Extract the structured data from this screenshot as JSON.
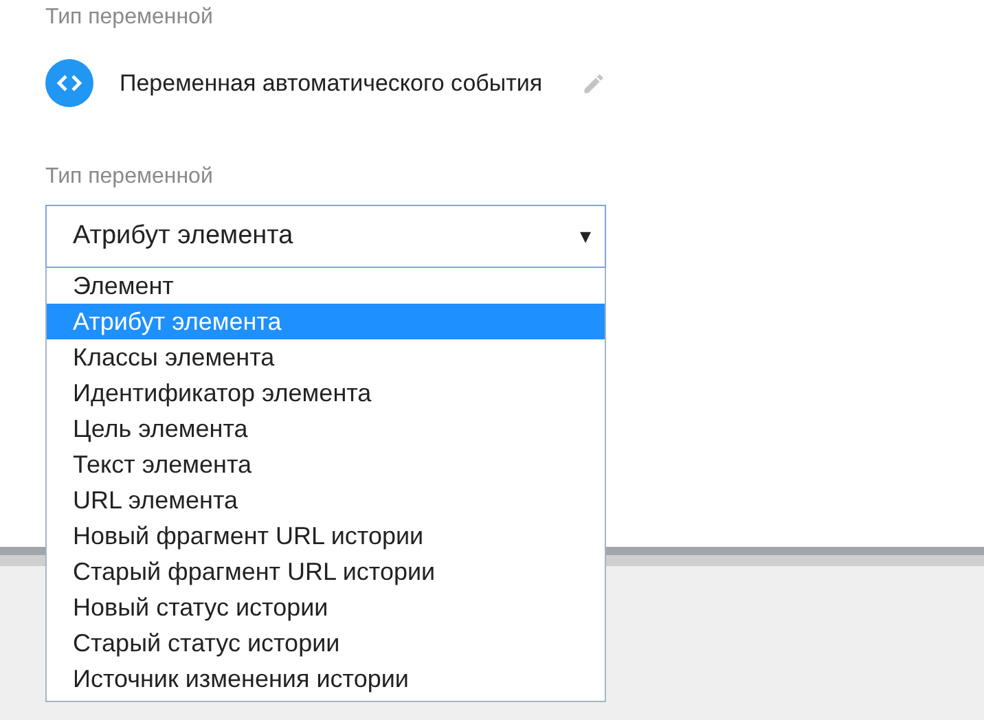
{
  "variable_type": {
    "label": "Тип переменной",
    "name": "Переменная автоматического события"
  },
  "select": {
    "label": "Тип переменной",
    "value": "Атрибут элемента",
    "caret": "▾",
    "expanded": true
  },
  "options": [
    {
      "label": "Элемент",
      "selected": false
    },
    {
      "label": "Атрибут элемента",
      "selected": true
    },
    {
      "label": "Классы элемента",
      "selected": false
    },
    {
      "label": "Идентификатор элемента",
      "selected": false
    },
    {
      "label": "Цель элемента",
      "selected": false
    },
    {
      "label": "Текст элемента",
      "selected": false
    },
    {
      "label": "URL элемента",
      "selected": false
    },
    {
      "label": "Новый фрагмент URL истории",
      "selected": false
    },
    {
      "label": "Старый фрагмент URL истории",
      "selected": false
    },
    {
      "label": "Новый статус истории",
      "selected": false
    },
    {
      "label": "Старый статус истории",
      "selected": false
    },
    {
      "label": "Источник изменения истории",
      "selected": false
    }
  ]
}
